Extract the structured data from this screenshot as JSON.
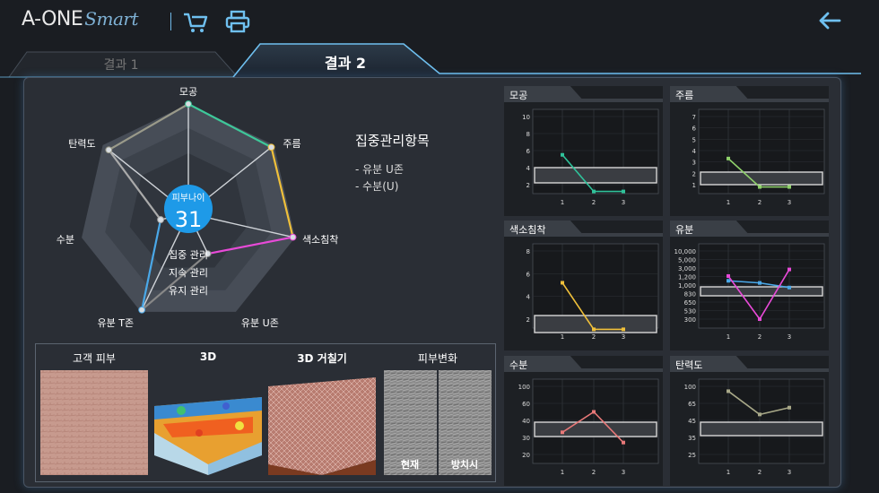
{
  "header": {
    "logo_main": "A-ONE",
    "logo_script": "Smart"
  },
  "tabs": [
    {
      "label": "결과 1"
    },
    {
      "label": "결과 2"
    }
  ],
  "radar": {
    "axes": [
      "모공",
      "주름",
      "색소침착",
      "유분 U존",
      "유분 T존",
      "수분",
      "탄력도"
    ],
    "values": [
      1.0,
      0.97,
      0.98,
      0.41,
      0.98,
      0.26,
      0.93
    ],
    "axis_colors": [
      "#3ec89a",
      "#f0c03a",
      "#e84ad8",
      "#888888",
      "#4aa8e8",
      "#aaaaaa",
      "#9a9a8a"
    ],
    "center_label": "피부나이",
    "center_value": "31",
    "legend": [
      "집중 관리",
      "지속 관리",
      "유지 관리"
    ]
  },
  "focus": {
    "title": "집중관리항목",
    "items": [
      "- 유분 U존",
      "- 수분(U)"
    ]
  },
  "images": [
    {
      "title": "고객 피부"
    },
    {
      "title": "3D"
    },
    {
      "title": "3D 거칠기"
    },
    {
      "title": "피부변화",
      "captions": [
        "현재",
        "방치시"
      ]
    }
  ],
  "chart_data": [
    {
      "type": "line",
      "title": "모공",
      "x": [
        1,
        2,
        3
      ],
      "values": [
        5.5,
        1.2,
        1.2
      ],
      "yticks": [
        "10",
        "8",
        "6",
        "4",
        "2"
      ],
      "color": "#2fc29a"
    },
    {
      "type": "line",
      "title": "주름",
      "x": [
        1,
        2,
        3
      ],
      "values": [
        3.3,
        0.8,
        0.8
      ],
      "yticks": [
        "7",
        "6",
        "5",
        "4",
        "3",
        "2",
        "1"
      ],
      "color": "#8ed06a"
    },
    {
      "type": "line",
      "title": "색소침착",
      "x": [
        1,
        2,
        3
      ],
      "values": [
        5.2,
        1.1,
        1.1
      ],
      "yticks": [
        "8",
        "6",
        "4",
        "2"
      ],
      "color": "#f0c03a"
    },
    {
      "type": "line",
      "title": "유분",
      "x": [
        1,
        2,
        3
      ],
      "values": [
        1300,
        300,
        2700
      ],
      "yticks": [
        "10,000",
        "5,000",
        "3,000",
        "1,200",
        "1,000",
        "830",
        "650",
        "530",
        "300"
      ],
      "series_secondary": [
        1100,
        1050,
        950
      ],
      "color": "#e84ad8",
      "color2": "#4aa8e8"
    },
    {
      "type": "line",
      "title": "수분",
      "x": [
        1,
        2,
        3
      ],
      "values": [
        33,
        50,
        27
      ],
      "yticks": [
        "100",
        "60",
        "40",
        "30",
        "20"
      ],
      "color": "#e87878"
    },
    {
      "type": "line",
      "title": "탄력도",
      "x": [
        1,
        2,
        3
      ],
      "values": [
        90,
        52,
        60
      ],
      "yticks": [
        "100",
        "65",
        "45",
        "35",
        "25"
      ],
      "color": "#a8a888"
    }
  ]
}
